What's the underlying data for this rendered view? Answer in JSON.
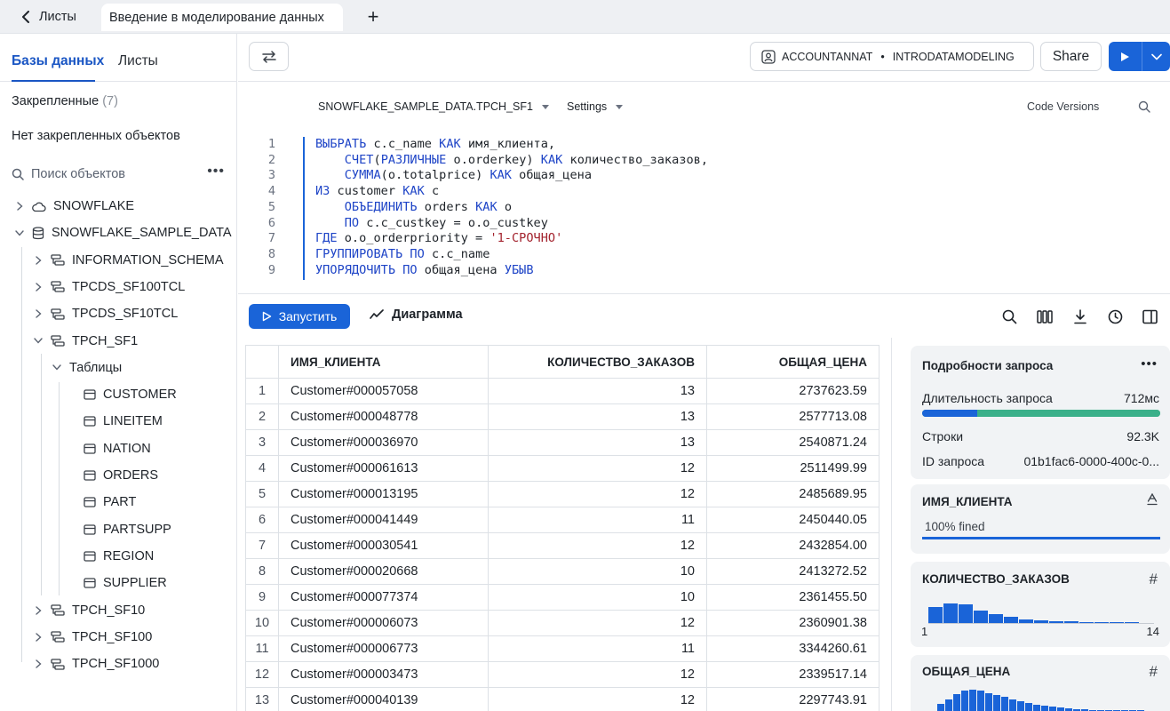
{
  "tabs": {
    "back_label": "Листы",
    "active_label": "Введение в моделирование данных",
    "new_tab_symbol": "+"
  },
  "sidebar": {
    "tabs": [
      {
        "label": "Базы данных",
        "active": true
      },
      {
        "label": "Листы",
        "active": false
      }
    ],
    "pinned_label": "Закрепленные",
    "pinned_count": "(7)",
    "no_pinned": "Нет закрепленных объектов",
    "search_placeholder": "Поиск объектов",
    "tree": [
      {
        "label": "SNOWFLAKE",
        "icon": "cloud-icon",
        "expanded": false,
        "level": 0
      },
      {
        "label": "SNOWFLAKE_SAMPLE_DATA",
        "icon": "database-icon",
        "expanded": true,
        "level": 0
      },
      {
        "label": "INFORMATION_SCHEMA",
        "icon": "schema-icon",
        "expanded": false,
        "level": 1
      },
      {
        "label": "TPCDS_SF100TCL",
        "icon": "schema-icon",
        "expanded": false,
        "level": 1
      },
      {
        "label": "TPCDS_SF10TCL",
        "icon": "schema-icon",
        "expanded": false,
        "level": 1
      },
      {
        "label": "TPCH_SF1",
        "icon": "schema-icon",
        "expanded": true,
        "level": 1
      },
      {
        "label": "Таблицы",
        "icon": "",
        "expanded": true,
        "level": 2
      },
      {
        "label": "CUSTOMER",
        "icon": "table-icon",
        "level": 3
      },
      {
        "label": "LINEITEM",
        "icon": "table-icon",
        "level": 3
      },
      {
        "label": "NATION",
        "icon": "table-icon",
        "level": 3
      },
      {
        "label": "ORDERS",
        "icon": "table-icon",
        "level": 3
      },
      {
        "label": "PART",
        "icon": "table-icon",
        "level": 3
      },
      {
        "label": "PARTSUPP",
        "icon": "table-icon",
        "level": 3
      },
      {
        "label": "REGION",
        "icon": "table-icon",
        "level": 3
      },
      {
        "label": "SUPPLIER",
        "icon": "table-icon",
        "level": 3
      },
      {
        "label": "TPCH_SF10",
        "icon": "schema-icon",
        "expanded": false,
        "level": 1
      },
      {
        "label": "TPCH_SF100",
        "icon": "schema-icon",
        "expanded": false,
        "level": 1
      },
      {
        "label": "TPCH_SF1000",
        "icon": "schema-icon",
        "expanded": false,
        "level": 1
      }
    ]
  },
  "toolbar": {
    "role": "ACCOUNTANNAT",
    "warehouse": "INTRODATAMODELING",
    "share_label": "Share"
  },
  "editor": {
    "database": "SNOWFLAKE_SAMPLE_DATA.TPCH_SF1",
    "settings_label": "Settings",
    "code_versions_label": "Code Versions",
    "lines": [
      [
        {
          "t": "ВЫБРАТЬ",
          "c": "kw"
        },
        {
          "t": " c.c_name ",
          "c": "plain"
        },
        {
          "t": "КАК",
          "c": "kw"
        },
        {
          "t": " имя_клиента,",
          "c": "plain"
        }
      ],
      [
        {
          "t": "    ",
          "c": "plain"
        },
        {
          "t": "СЧЕТ",
          "c": "kw"
        },
        {
          "t": "(",
          "c": "plain"
        },
        {
          "t": "РАЗЛИЧНЫЕ",
          "c": "kw"
        },
        {
          "t": " o.orderkey) ",
          "c": "plain"
        },
        {
          "t": "КАК",
          "c": "kw"
        },
        {
          "t": " количество_заказов,",
          "c": "plain"
        }
      ],
      [
        {
          "t": "    ",
          "c": "plain"
        },
        {
          "t": "СУММА",
          "c": "kw"
        },
        {
          "t": "(o.totalprice) ",
          "c": "plain"
        },
        {
          "t": "КАК",
          "c": "kw"
        },
        {
          "t": " общая_цена",
          "c": "plain"
        }
      ],
      [
        {
          "t": "ИЗ",
          "c": "kw"
        },
        {
          "t": " customer ",
          "c": "plain"
        },
        {
          "t": "КАК",
          "c": "kw"
        },
        {
          "t": " c",
          "c": "plain"
        }
      ],
      [
        {
          "t": "    ",
          "c": "plain"
        },
        {
          "t": "ОБЪЕДИНИТЬ",
          "c": "kw"
        },
        {
          "t": " orders ",
          "c": "plain"
        },
        {
          "t": "КАК",
          "c": "kw"
        },
        {
          "t": " o",
          "c": "plain"
        }
      ],
      [
        {
          "t": "    ",
          "c": "plain"
        },
        {
          "t": "ПО",
          "c": "kw"
        },
        {
          "t": " c.c_custkey = o.o_custkey",
          "c": "plain"
        }
      ],
      [
        {
          "t": "ГДЕ",
          "c": "kw"
        },
        {
          "t": " o.o_orderpriority = ",
          "c": "plain"
        },
        {
          "t": "'1-СРОЧНО'",
          "c": "str"
        }
      ],
      [
        {
          "t": "ГРУППИРОВАТЬ",
          "c": "kw"
        },
        {
          "t": " ",
          "c": "plain"
        },
        {
          "t": "ПО",
          "c": "kw"
        },
        {
          "t": " c.c_name",
          "c": "plain"
        }
      ],
      [
        {
          "t": "УПОРЯДОЧИТЬ",
          "c": "kw"
        },
        {
          "t": " ",
          "c": "plain"
        },
        {
          "t": "ПО",
          "c": "kw"
        },
        {
          "t": " общая_цена ",
          "c": "plain"
        },
        {
          "t": "УБЫВ",
          "c": "kw"
        }
      ]
    ]
  },
  "results": {
    "run_label": "Запустить",
    "chart_label": "Диаграмма",
    "columns": [
      "ИМЯ_КЛИЕНТА",
      "КОЛИЧЕСТВО_ЗАКАЗОВ",
      "ОБЩАЯ_ЦЕНА"
    ],
    "rows": [
      [
        "1",
        "Customer#000057058",
        "13",
        "2737623.59"
      ],
      [
        "2",
        "Customer#000048778",
        "13",
        "2577713.08"
      ],
      [
        "3",
        "Customer#000036970",
        "13",
        "2540871.24"
      ],
      [
        "4",
        "Customer#000061613",
        "12",
        "2511499.99"
      ],
      [
        "5",
        "Customer#000013195",
        "12",
        "2485689.95"
      ],
      [
        "6",
        "Customer#000041449",
        "11",
        "2450440.05"
      ],
      [
        "7",
        "Customer#000030541",
        "12",
        "2432854.00"
      ],
      [
        "8",
        "Customer#000020668",
        "10",
        "2413272.52"
      ],
      [
        "9",
        "Customer#000077374",
        "10",
        "2361455.50"
      ],
      [
        "10",
        "Customer#000006073",
        "12",
        "2360901.38"
      ],
      [
        "11",
        "Customer#000006773",
        "11",
        "3344260.61"
      ],
      [
        "12",
        "Customer#000003473",
        "12",
        "2339517.14"
      ],
      [
        "13",
        "Customer#000040139",
        "12",
        "2297743.91"
      ]
    ]
  },
  "details": {
    "title": "Подробности запроса",
    "duration_label": "Длительность запроса",
    "duration_value": "712мс",
    "duration_split": {
      "blue": 0.23,
      "green": 0.77
    },
    "rows_label": "Строки",
    "rows_value": "92.3K",
    "query_id_label": "ID запроса",
    "query_id_value": "01b1fac6-0000-400c-0..."
  },
  "col_stats": {
    "name_title": "ИМЯ_КЛИЕНТА",
    "name_filled": "100% fined",
    "name_filled_fraction": 1.0,
    "count_title": "КОЛИЧЕСТВО_ЗАКАЗОВ",
    "count_min": "1",
    "count_max": "14",
    "count_hist": [
      0.8,
      1.0,
      0.95,
      0.65,
      0.45,
      0.3,
      0.2,
      0.14,
      0.1,
      0.08,
      0.06,
      0.05,
      0.04,
      0.03
    ],
    "price_title": "ОБЩАЯ_ЦЕНА",
    "price_hist": [
      0.35,
      0.55,
      0.8,
      0.95,
      1.0,
      0.95,
      0.85,
      0.75,
      0.65,
      0.55,
      0.45,
      0.38,
      0.3,
      0.25,
      0.2,
      0.15,
      0.12,
      0.1,
      0.08,
      0.06,
      0.05,
      0.04,
      0.04,
      0.03,
      0.03,
      0.02
    ]
  },
  "colors": {
    "accent": "#1a64d8",
    "bar_blue": "#1a64d8",
    "bar_green": "#3bb08a"
  }
}
